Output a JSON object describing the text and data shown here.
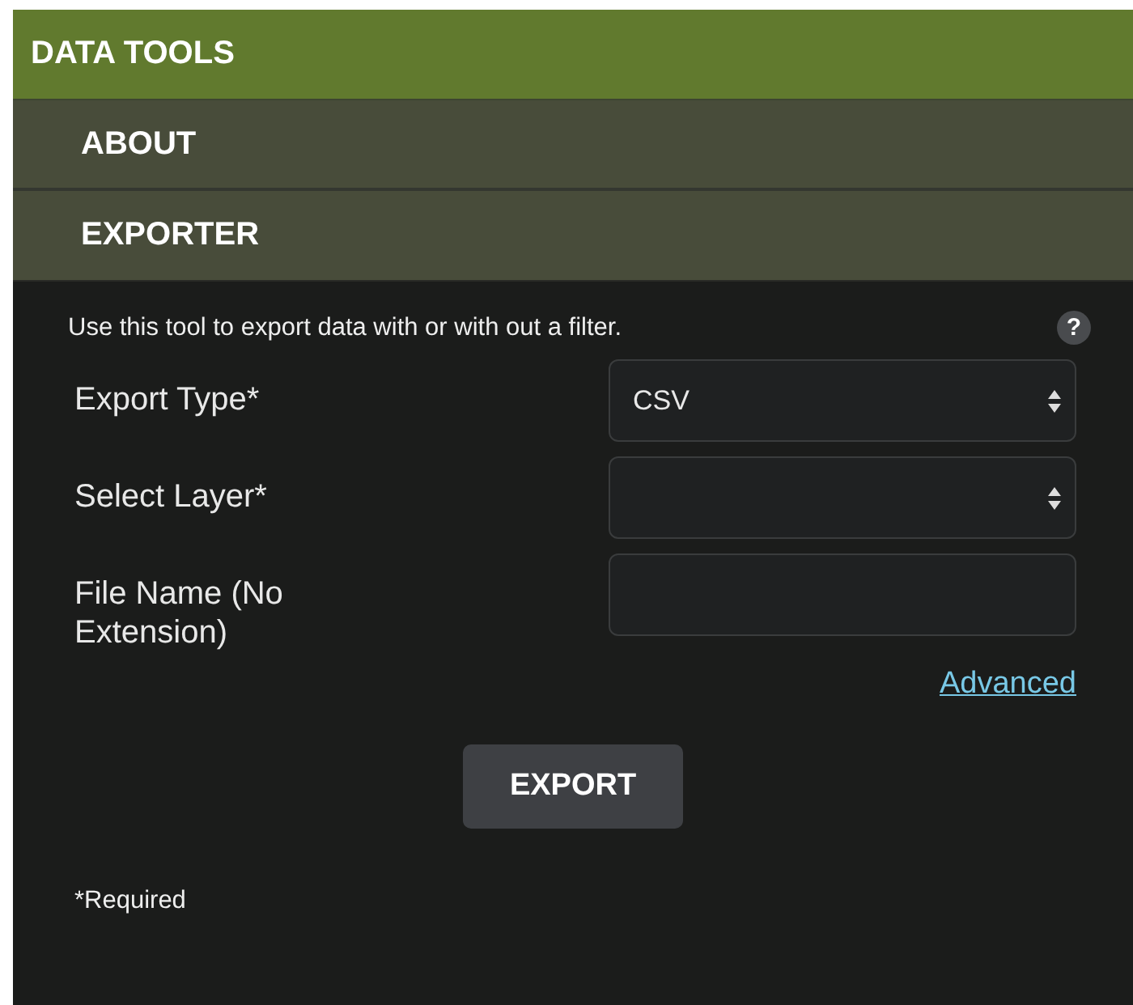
{
  "panel": {
    "title": "DATA TOOLS"
  },
  "sections": [
    {
      "label": "ABOUT",
      "expanded": false
    },
    {
      "label": "EXPORTER",
      "expanded": true
    }
  ],
  "exporter": {
    "description": "Use this tool to export data with or with out a filter.",
    "help": "?",
    "fields": [
      {
        "kind": "select",
        "label": "Export Type*",
        "value": "CSV"
      },
      {
        "kind": "select",
        "label": "Select Layer*"
      },
      {
        "kind": "text",
        "label": "File Name (No Extension)"
      }
    ],
    "advanced_link": "Advanced",
    "export_button": "EXPORT",
    "footnote": "*Required"
  }
}
